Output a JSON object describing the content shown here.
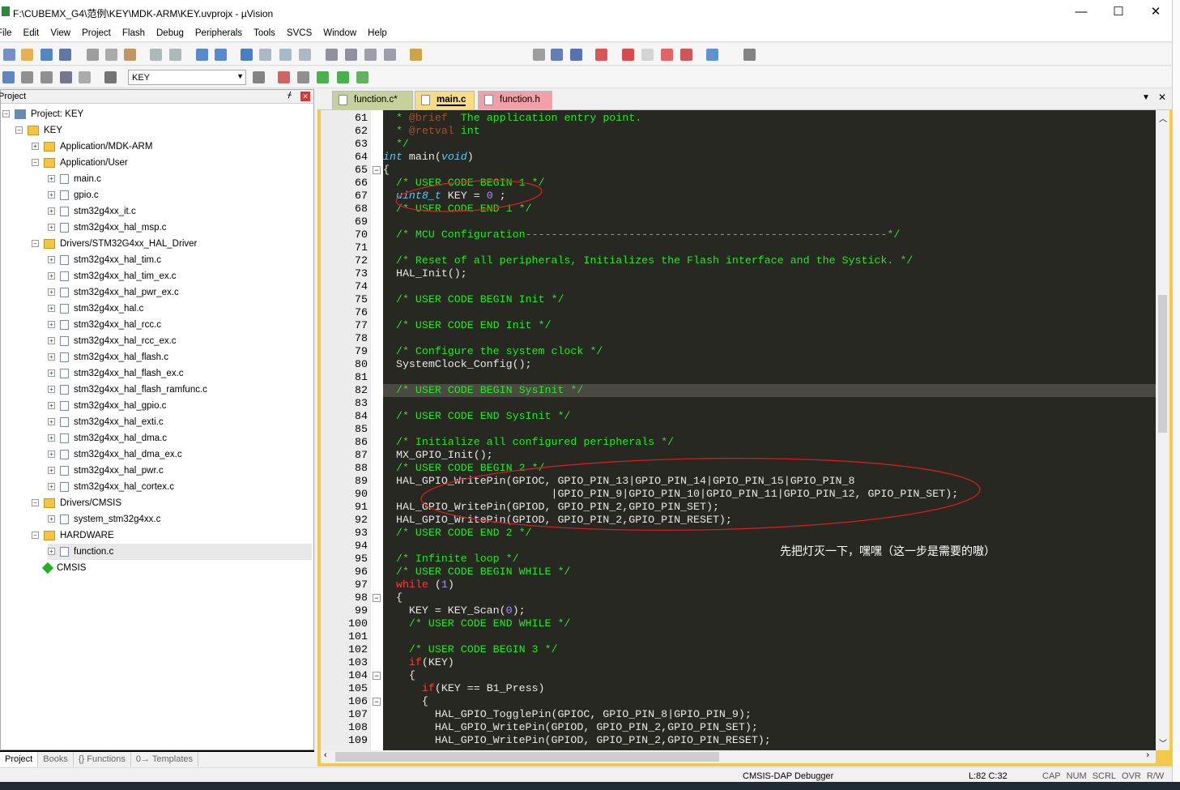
{
  "window": {
    "title": "F:\\CUBEMX_G4\\范例\\KEY\\MDK-ARM\\KEY.uvprojx - µVision",
    "minimize": "—",
    "maximize": "☐",
    "close": "✕"
  },
  "menu": [
    "File",
    "Edit",
    "View",
    "Project",
    "Flash",
    "Debug",
    "Peripherals",
    "Tools",
    "SVCS",
    "Window",
    "Help"
  ],
  "toolbar2": {
    "target": "KEY"
  },
  "project_panel": {
    "title": "Project",
    "tree": [
      {
        "label": "Project: KEY",
        "depth": 0,
        "icon": "project-icon",
        "exp": "−"
      },
      {
        "label": "KEY",
        "depth": 1,
        "icon": "target-folder-icon",
        "exp": "−"
      },
      {
        "label": "Application/MDK-ARM",
        "depth": 2,
        "icon": "folder-icon",
        "exp": "+"
      },
      {
        "label": "Application/User",
        "depth": 2,
        "icon": "folder-icon",
        "exp": "−"
      },
      {
        "label": "main.c",
        "depth": 3,
        "icon": "file-icon",
        "exp": "+"
      },
      {
        "label": "gpio.c",
        "depth": 3,
        "icon": "file-icon",
        "exp": "+"
      },
      {
        "label": "stm32g4xx_it.c",
        "depth": 3,
        "icon": "file-icon",
        "exp": "+"
      },
      {
        "label": "stm32g4xx_hal_msp.c",
        "depth": 3,
        "icon": "file-icon",
        "exp": "+"
      },
      {
        "label": "Drivers/STM32G4xx_HAL_Driver",
        "depth": 2,
        "icon": "folder-icon",
        "exp": "−"
      },
      {
        "label": "stm32g4xx_hal_tim.c",
        "depth": 3,
        "icon": "file-icon",
        "exp": "+"
      },
      {
        "label": "stm32g4xx_hal_tim_ex.c",
        "depth": 3,
        "icon": "file-icon",
        "exp": "+"
      },
      {
        "label": "stm32g4xx_hal_pwr_ex.c",
        "depth": 3,
        "icon": "file-icon",
        "exp": "+"
      },
      {
        "label": "stm32g4xx_hal.c",
        "depth": 3,
        "icon": "file-icon",
        "exp": "+"
      },
      {
        "label": "stm32g4xx_hal_rcc.c",
        "depth": 3,
        "icon": "file-icon",
        "exp": "+"
      },
      {
        "label": "stm32g4xx_hal_rcc_ex.c",
        "depth": 3,
        "icon": "file-icon",
        "exp": "+"
      },
      {
        "label": "stm32g4xx_hal_flash.c",
        "depth": 3,
        "icon": "file-icon",
        "exp": "+"
      },
      {
        "label": "stm32g4xx_hal_flash_ex.c",
        "depth": 3,
        "icon": "file-icon",
        "exp": "+"
      },
      {
        "label": "stm32g4xx_hal_flash_ramfunc.c",
        "depth": 3,
        "icon": "file-icon",
        "exp": "+"
      },
      {
        "label": "stm32g4xx_hal_gpio.c",
        "depth": 3,
        "icon": "file-icon",
        "exp": "+"
      },
      {
        "label": "stm32g4xx_hal_exti.c",
        "depth": 3,
        "icon": "file-icon",
        "exp": "+"
      },
      {
        "label": "stm32g4xx_hal_dma.c",
        "depth": 3,
        "icon": "file-icon",
        "exp": "+"
      },
      {
        "label": "stm32g4xx_hal_dma_ex.c",
        "depth": 3,
        "icon": "file-icon",
        "exp": "+"
      },
      {
        "label": "stm32g4xx_hal_pwr.c",
        "depth": 3,
        "icon": "file-icon",
        "exp": "+"
      },
      {
        "label": "stm32g4xx_hal_cortex.c",
        "depth": 3,
        "icon": "file-icon",
        "exp": "+"
      },
      {
        "label": "Drivers/CMSIS",
        "depth": 2,
        "icon": "folder-icon",
        "exp": "−"
      },
      {
        "label": "system_stm32g4xx.c",
        "depth": 3,
        "icon": "file-icon",
        "exp": "+"
      },
      {
        "label": "HARDWARE",
        "depth": 2,
        "icon": "folder-icon",
        "exp": "−"
      },
      {
        "label": "function.c",
        "depth": 3,
        "icon": "file-icon",
        "exp": "+",
        "selected": true
      },
      {
        "label": "CMSIS",
        "depth": 2,
        "icon": "diamond-icon",
        "exp": ""
      }
    ],
    "tabs": [
      {
        "label": "Project",
        "active": true
      },
      {
        "label": "Books"
      },
      {
        "label": "{} Functions"
      },
      {
        "label": "0→ Templates"
      }
    ]
  },
  "editor": {
    "tabs": [
      {
        "label": "function.c*",
        "color": "#c5d09a"
      },
      {
        "label": "main.c",
        "color": "#f7dc82",
        "active": true
      },
      {
        "label": "function.h",
        "color": "#f0a0a8"
      }
    ],
    "first_line": 61,
    "highlight_line": 82,
    "lines": [
      [
        [
          "  * ",
          "c"
        ],
        [
          "@brief",
          "t"
        ],
        [
          "  The application entry point.",
          "c"
        ]
      ],
      [
        [
          "  * ",
          "c"
        ],
        [
          "@retval",
          "t"
        ],
        [
          " int",
          "c"
        ]
      ],
      [
        [
          "  */",
          "c"
        ]
      ],
      [
        [
          "int",
          "k"
        ],
        [
          " main(",
          "p"
        ],
        [
          "void",
          "k"
        ],
        [
          ")",
          "p"
        ]
      ],
      [
        [
          "{",
          "p"
        ]
      ],
      [
        [
          "  /* USER CODE BEGIN 1 */",
          "c"
        ]
      ],
      [
        [
          "  ",
          "p"
        ],
        [
          "uint8_t",
          "k"
        ],
        [
          " KEY = ",
          "p"
        ],
        [
          "0",
          "n"
        ],
        [
          " ;",
          "p"
        ]
      ],
      [
        [
          "  /* USER CODE END 1 */",
          "c"
        ]
      ],
      [],
      [
        [
          "  /* MCU Configuration--------------------------------------------------------*/",
          "c"
        ]
      ],
      [],
      [
        [
          "  /* Reset of all peripherals, Initializes the Flash interface and the Systick. */",
          "c"
        ]
      ],
      [
        [
          "  HAL_Init();",
          "p"
        ]
      ],
      [],
      [
        [
          "  /* USER CODE BEGIN Init */",
          "c"
        ]
      ],
      [],
      [
        [
          "  /* USER CODE END Init */",
          "c"
        ]
      ],
      [],
      [
        [
          "  /* Configure the system clock */",
          "c"
        ]
      ],
      [
        [
          "  SystemClock_Config();",
          "p"
        ]
      ],
      [],
      [
        [
          "  /* USER CODE BEGIN SysInit */",
          "c"
        ]
      ],
      [],
      [
        [
          "  /* USER CODE END SysInit */",
          "c"
        ]
      ],
      [],
      [
        [
          "  /* Initialize all configured peripherals */",
          "c"
        ]
      ],
      [
        [
          "  MX_GPIO_Init();",
          "p"
        ]
      ],
      [
        [
          "  /* USER CODE BEGIN 2 */",
          "c"
        ]
      ],
      [
        [
          "  HAL_GPIO_WritePin(GPIOC, GPIO_PIN_13|GPIO_PIN_14|GPIO_PIN_15|GPIO_PIN_8",
          "p"
        ]
      ],
      [
        [
          "                          |GPIO_PIN_9|GPIO_PIN_10|GPIO_PIN_11|GPIO_PIN_12, GPIO_PIN_SET);",
          "p"
        ]
      ],
      [
        [
          "  HAL_GPIO_WritePin(GPIOD, GPIO_PIN_2,GPIO_PIN_SET);",
          "p"
        ]
      ],
      [
        [
          "  HAL_GPIO_WritePin(GPIOD, GPIO_PIN_2,GPIO_PIN_RESET);",
          "p"
        ]
      ],
      [
        [
          "  /* USER CODE END 2 */",
          "c"
        ]
      ],
      [],
      [
        [
          "  /* Infinite loop */",
          "c"
        ]
      ],
      [
        [
          "  /* USER CODE BEGIN WHILE */",
          "c"
        ]
      ],
      [
        [
          "  ",
          "p"
        ],
        [
          "while",
          "r"
        ],
        [
          " (",
          "p"
        ],
        [
          "1",
          "n"
        ],
        [
          ")",
          "p"
        ]
      ],
      [
        [
          "  {",
          "p"
        ]
      ],
      [
        [
          "    KEY = KEY_Scan(",
          "p"
        ],
        [
          "0",
          "n"
        ],
        [
          ");",
          "p"
        ]
      ],
      [
        [
          "    /* USER CODE END WHILE */",
          "c"
        ]
      ],
      [],
      [
        [
          "    /* USER CODE BEGIN 3 */",
          "c"
        ]
      ],
      [
        [
          "    ",
          "p"
        ],
        [
          "if",
          "r"
        ],
        [
          "(KEY)",
          "p"
        ]
      ],
      [
        [
          "    {",
          "p"
        ]
      ],
      [
        [
          "      ",
          "p"
        ],
        [
          "if",
          "r"
        ],
        [
          "(KEY == B1_Press)",
          "p"
        ]
      ],
      [
        [
          "      {",
          "p"
        ]
      ],
      [
        [
          "        HAL_GPIO_TogglePin(GPIOC, GPIO_PIN_8|GPIO_PIN_9);",
          "p"
        ]
      ],
      [
        [
          "        HAL_GPIO_WritePin(GPIOD, GPIO_PIN_2,GPIO_PIN_SET);",
          "p"
        ]
      ],
      [
        [
          "        HAL_GPIO_WritePin(GPIOD, GPIO_PIN_2,GPIO_PIN_RESET);",
          "p"
        ]
      ]
    ],
    "fold_lines": [
      65,
      98,
      104,
      106
    ],
    "annotation_note": "先把灯灭一下，嘿嘿（这一步是需要的嗷）",
    "annotation_color": "#d02020"
  },
  "status": {
    "debugger": "CMSIS-DAP Debugger",
    "position": "L:82 C:32",
    "indicators": [
      "CAP",
      "NUM",
      "SCRL",
      "OVR",
      "R/W"
    ]
  }
}
